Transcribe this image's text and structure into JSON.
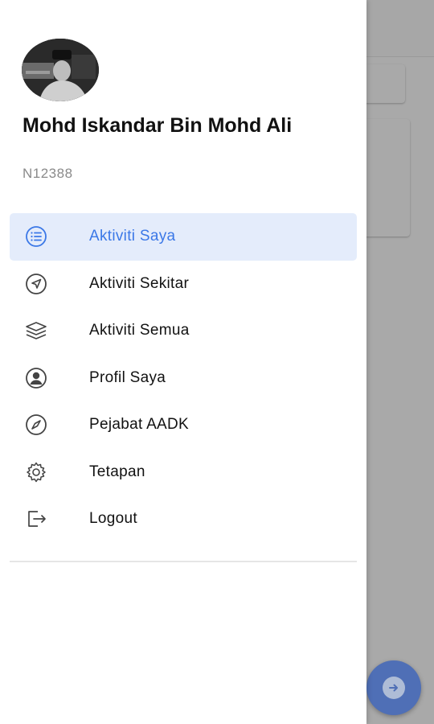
{
  "drawer": {
    "user": {
      "name": "Mohd Iskandar Bin Mohd Ali",
      "id": "N12388"
    },
    "menu": [
      {
        "label": "Aktiviti Saya",
        "icon": "list-icon",
        "active": true
      },
      {
        "label": "Aktiviti Sekitar",
        "icon": "navigation-icon",
        "active": false
      },
      {
        "label": "Aktiviti Semua",
        "icon": "layers-icon",
        "active": false
      },
      {
        "label": "Profil Saya",
        "icon": "user-circle-icon",
        "active": false
      },
      {
        "label": "Pejabat AADK",
        "icon": "compass-icon",
        "active": false
      },
      {
        "label": "Tetapan",
        "icon": "settings-icon",
        "active": false
      },
      {
        "label": "Logout",
        "icon": "logout-icon",
        "active": false
      }
    ]
  },
  "colors": {
    "accent": "#3b78e7",
    "active_bg": "#e4ecfb",
    "fab": "#4f6fb6",
    "overlay": "#a9a9a9"
  }
}
